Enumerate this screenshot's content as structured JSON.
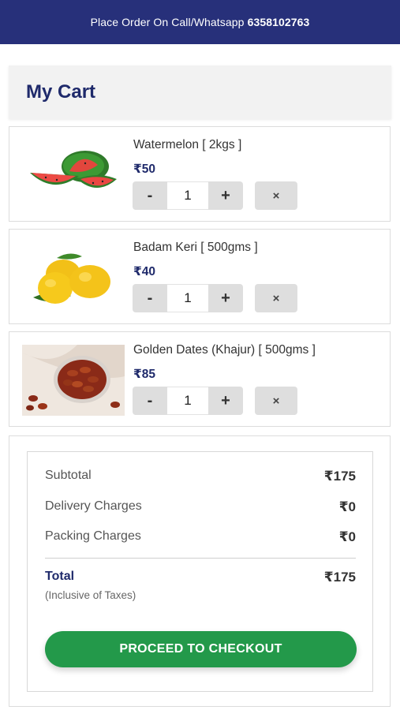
{
  "topbar": {
    "text": "Place Order On Call/Whatsapp",
    "phone": "6358102763"
  },
  "cart": {
    "title": "My Cart"
  },
  "items": [
    {
      "name": "Watermelon [ 2kgs ]",
      "price": "₹50",
      "qty": "1",
      "image_icon": "watermelon-image"
    },
    {
      "name": "Badam Keri [ 500gms ]",
      "price": "₹40",
      "qty": "1",
      "image_icon": "mango-image"
    },
    {
      "name": "Golden Dates (Khajur) [ 500gms ]",
      "price": "₹85",
      "qty": "1",
      "image_icon": "dates-image"
    }
  ],
  "controls": {
    "minus": "-",
    "plus": "+",
    "remove": "×"
  },
  "summary": {
    "subtotal_label": "Subtotal",
    "subtotal": "₹175",
    "delivery_label": "Delivery Charges",
    "delivery": "₹0",
    "packing_label": "Packing Charges",
    "packing": "₹0",
    "total_label": "Total",
    "total": "₹175",
    "tax_note": "(Inclusive of Taxes)"
  },
  "checkout_label": "PROCEED TO CHECKOUT",
  "colors": {
    "topbar": "#27307a",
    "accent_text": "#1f2a6b",
    "checkout": "#23994a"
  }
}
